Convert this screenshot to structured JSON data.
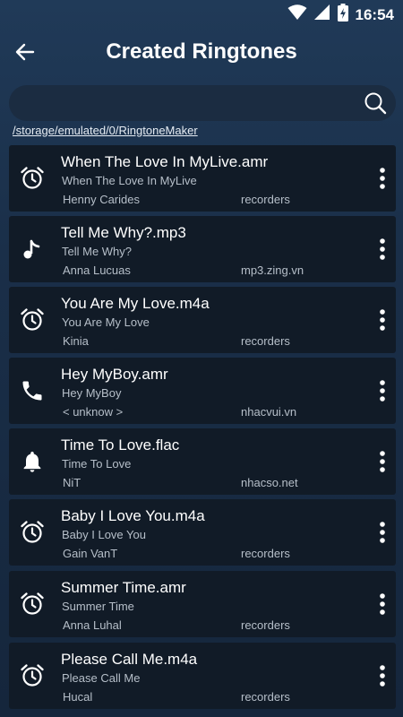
{
  "status_bar": {
    "time": "16:54",
    "icons": [
      "wifi-icon",
      "signal-icon",
      "battery-charging-icon"
    ]
  },
  "header": {
    "title": "Created Ringtones",
    "back_icon": "arrow-left-icon"
  },
  "search": {
    "placeholder": "",
    "icon": "search-icon"
  },
  "path": "/storage/emulated/0/RingtoneMaker",
  "items": [
    {
      "icon": "alarm-icon",
      "file_name": "When The Love In MyLive.amr",
      "title": "When The Love In MyLive",
      "artist": "Henny Carides",
      "source": "recorders"
    },
    {
      "icon": "music-note-icon",
      "file_name": "Tell Me Why?.mp3",
      "title": "Tell Me Why?",
      "artist": "Anna Lucuas",
      "source": "mp3.zing.vn"
    },
    {
      "icon": "alarm-icon",
      "file_name": "You Are My Love.m4a",
      "title": "You Are My Love",
      "artist": "Kinia",
      "source": "recorders"
    },
    {
      "icon": "phone-icon",
      "file_name": "Hey MyBoy.amr",
      "title": "Hey MyBoy",
      "artist": "< unknow >",
      "source": "nhacvui.vn"
    },
    {
      "icon": "bell-icon",
      "file_name": "Time To Love.flac",
      "title": "Time To Love",
      "artist": "NiT",
      "source": "nhacso.net"
    },
    {
      "icon": "alarm-icon",
      "file_name": "Baby I Love You.m4a",
      "title": "Baby I Love You",
      "artist": "Gain VanT",
      "source": "recorders"
    },
    {
      "icon": "alarm-icon",
      "file_name": "Summer Time.amr",
      "title": "Summer Time",
      "artist": "Anna Luhal",
      "source": "recorders"
    },
    {
      "icon": "alarm-icon",
      "file_name": "Please Call Me.m4a",
      "title": "Please Call Me",
      "artist": "Hucal",
      "source": "recorders"
    }
  ]
}
